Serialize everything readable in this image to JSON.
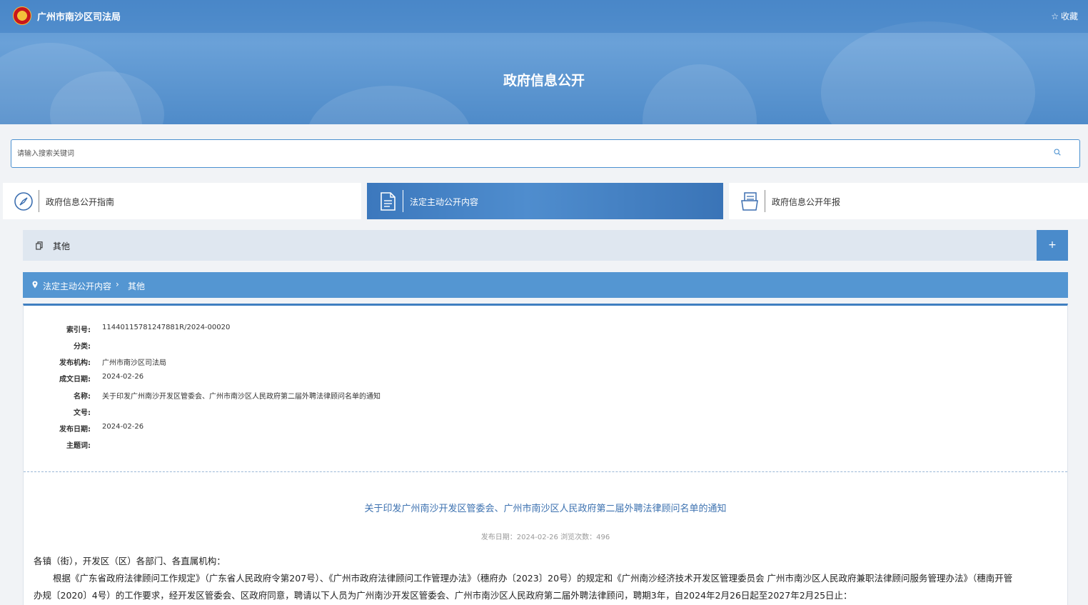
{
  "header": {
    "site_name": "广州市南沙区司法局",
    "favorite_label": "收藏",
    "banner_title": "政府信息公开"
  },
  "search": {
    "placeholder": "请输入搜索关键词"
  },
  "tabs": [
    {
      "label": "政府信息公开指南",
      "icon": "compass-icon"
    },
    {
      "label": "法定主动公开内容",
      "icon": "document-icon",
      "active": true
    },
    {
      "label": "政府信息公开年报",
      "icon": "report-icon"
    }
  ],
  "category": {
    "label": "其他",
    "expand_label": "+"
  },
  "breadcrumb": {
    "root": "法定主动公开内容",
    "separator": "›",
    "current": "其他"
  },
  "meta": [
    {
      "key": "索引号:",
      "value": "11440115781247881R/2024-00020"
    },
    {
      "key": "分类:",
      "value": ""
    },
    {
      "key": "发布机构:",
      "value": "广州市南沙区司法局"
    },
    {
      "key": "成文日期:",
      "value": "2024-02-26"
    },
    {
      "key": "名称:",
      "value": "关于印发广州南沙开发区管委会、广州市南沙区人民政府第二届外聘法律顾问名单的通知"
    },
    {
      "key": "文号:",
      "value": ""
    },
    {
      "key": "发布日期:",
      "value": "2024-02-26"
    },
    {
      "key": "主题词:",
      "value": ""
    }
  ],
  "document": {
    "title": "关于印发广州南沙开发区管委会、广州市南沙区人民政府第二届外聘法律顾问名单的通知",
    "publish_line": "发布日期：2024-02-26  浏览次数：496",
    "salutation": "各镇（街），开发区（区）各部门、各直属机构：",
    "paragraph_1": "根据《广东省政府法律顾问工作规定》（广东省人民政府令第207号）、《广州市政府法律顾问工作管理办法》（穗府办〔2023〕20号）的规定和《广州南沙经济技术开发区管理委员会 广州市南沙区人民政府兼职法律顾问服务管理办法》（穗南开管",
    "paragraph_2": "办规〔2020〕4号）的工作要求，经开发区管委会、区政府同意，聘请以下人员为广州南沙开发区管委会、广州市南沙区人民政府第二届外聘法律顾问，聘期3年，自2024年2月26日起至2027年2月25日止："
  },
  "colors": {
    "brand_blue": "#4f8bc9",
    "title_blue": "#3d72b0",
    "breadcrumb_bg": "#5496d2"
  }
}
